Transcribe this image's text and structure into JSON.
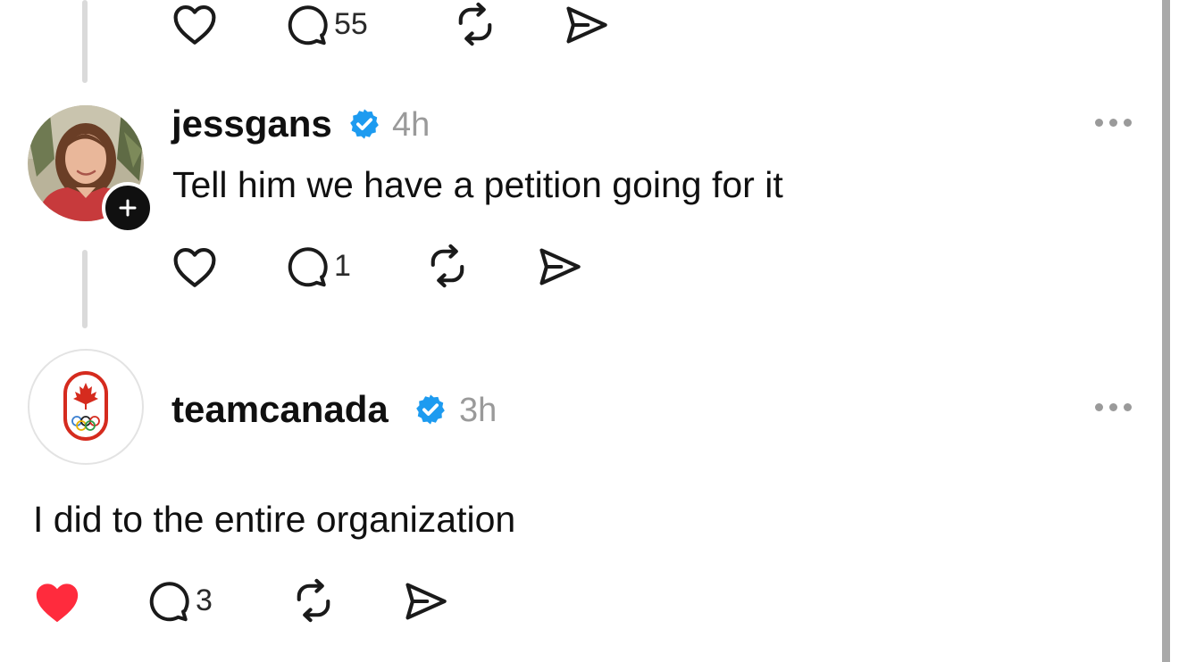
{
  "posts": [
    {
      "actions": {
        "like_icon": "heart-outline-icon",
        "comment_icon": "comment-bubble-icon",
        "comment_count": "55",
        "repost_icon": "repost-icon",
        "share_icon": "send-icon"
      }
    },
    {
      "username": "jessgans",
      "verified_icon": "verified-badge-icon",
      "timestamp": "4h",
      "text": "Tell him we have a petition going for it",
      "more_icon": "more-options-icon",
      "follow_icon": "plus-icon",
      "actions": {
        "like_icon": "heart-outline-icon",
        "comment_icon": "comment-bubble-icon",
        "comment_count": "1",
        "repost_icon": "repost-icon",
        "share_icon": "send-icon"
      }
    },
    {
      "username": "teamcanada",
      "verified_icon": "verified-badge-icon",
      "timestamp": "3h",
      "text": "I did to the entire organization",
      "more_icon": "more-options-icon",
      "actions": {
        "like_icon": "heart-filled-icon",
        "liked": true,
        "comment_icon": "comment-bubble-icon",
        "comment_count": "3",
        "repost_icon": "repost-icon",
        "share_icon": "send-icon"
      }
    }
  ],
  "colors": {
    "text": "#101010",
    "muted": "#9a9a9a",
    "verified_blue": "#1d9bf0",
    "like_red": "#ff2b3d",
    "canada_red": "#d52b1e"
  }
}
